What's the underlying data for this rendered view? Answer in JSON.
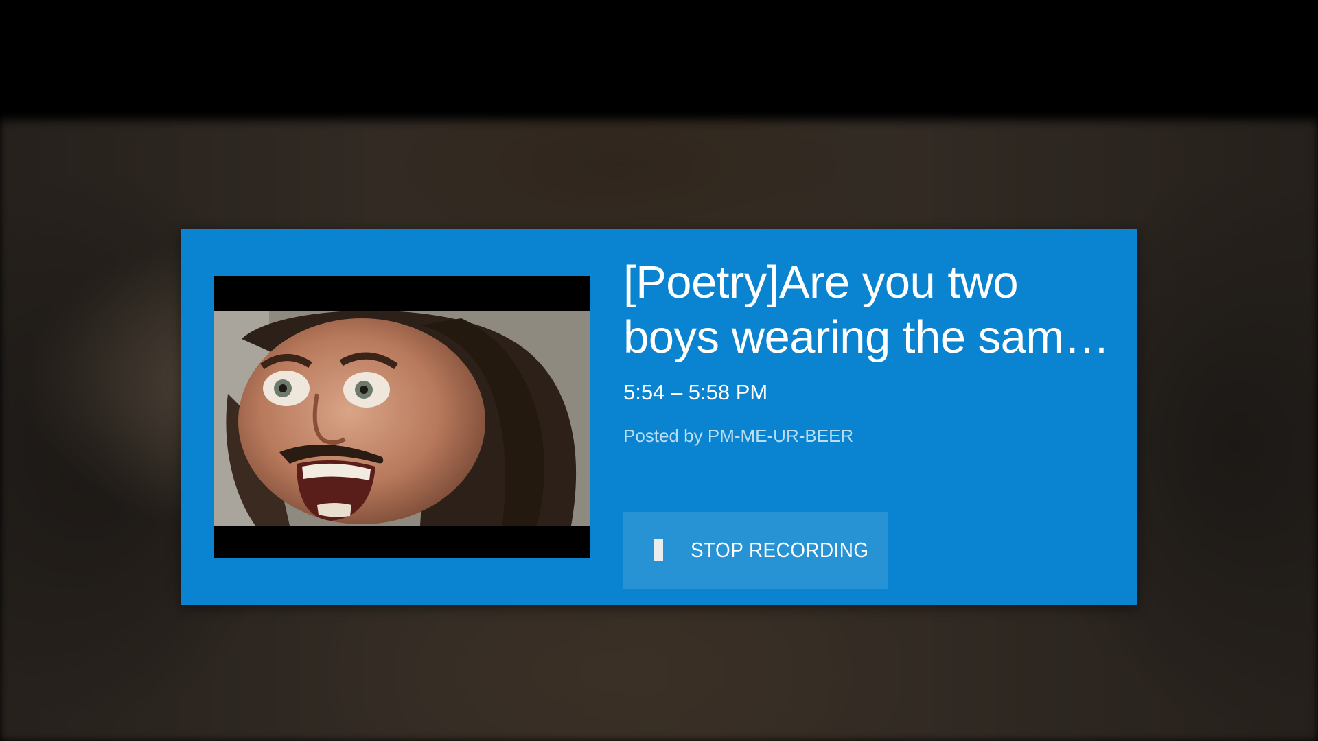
{
  "program": {
    "title": "[Poetry]Are you two boys wearing the sam…",
    "time_range": "5:54 – 5:58 PM",
    "posted_by": "Posted by PM-ME-UR-BEER",
    "thumbnail_icon": "video-thumbnail"
  },
  "actions": {
    "stop_recording_label": "STOP RECORDING",
    "stop_icon": "stop-square-icon"
  },
  "colors": {
    "card_background": "#0a84d0",
    "button_background": "rgba(255,255,255,0.12)",
    "text_primary": "#ffffff"
  }
}
